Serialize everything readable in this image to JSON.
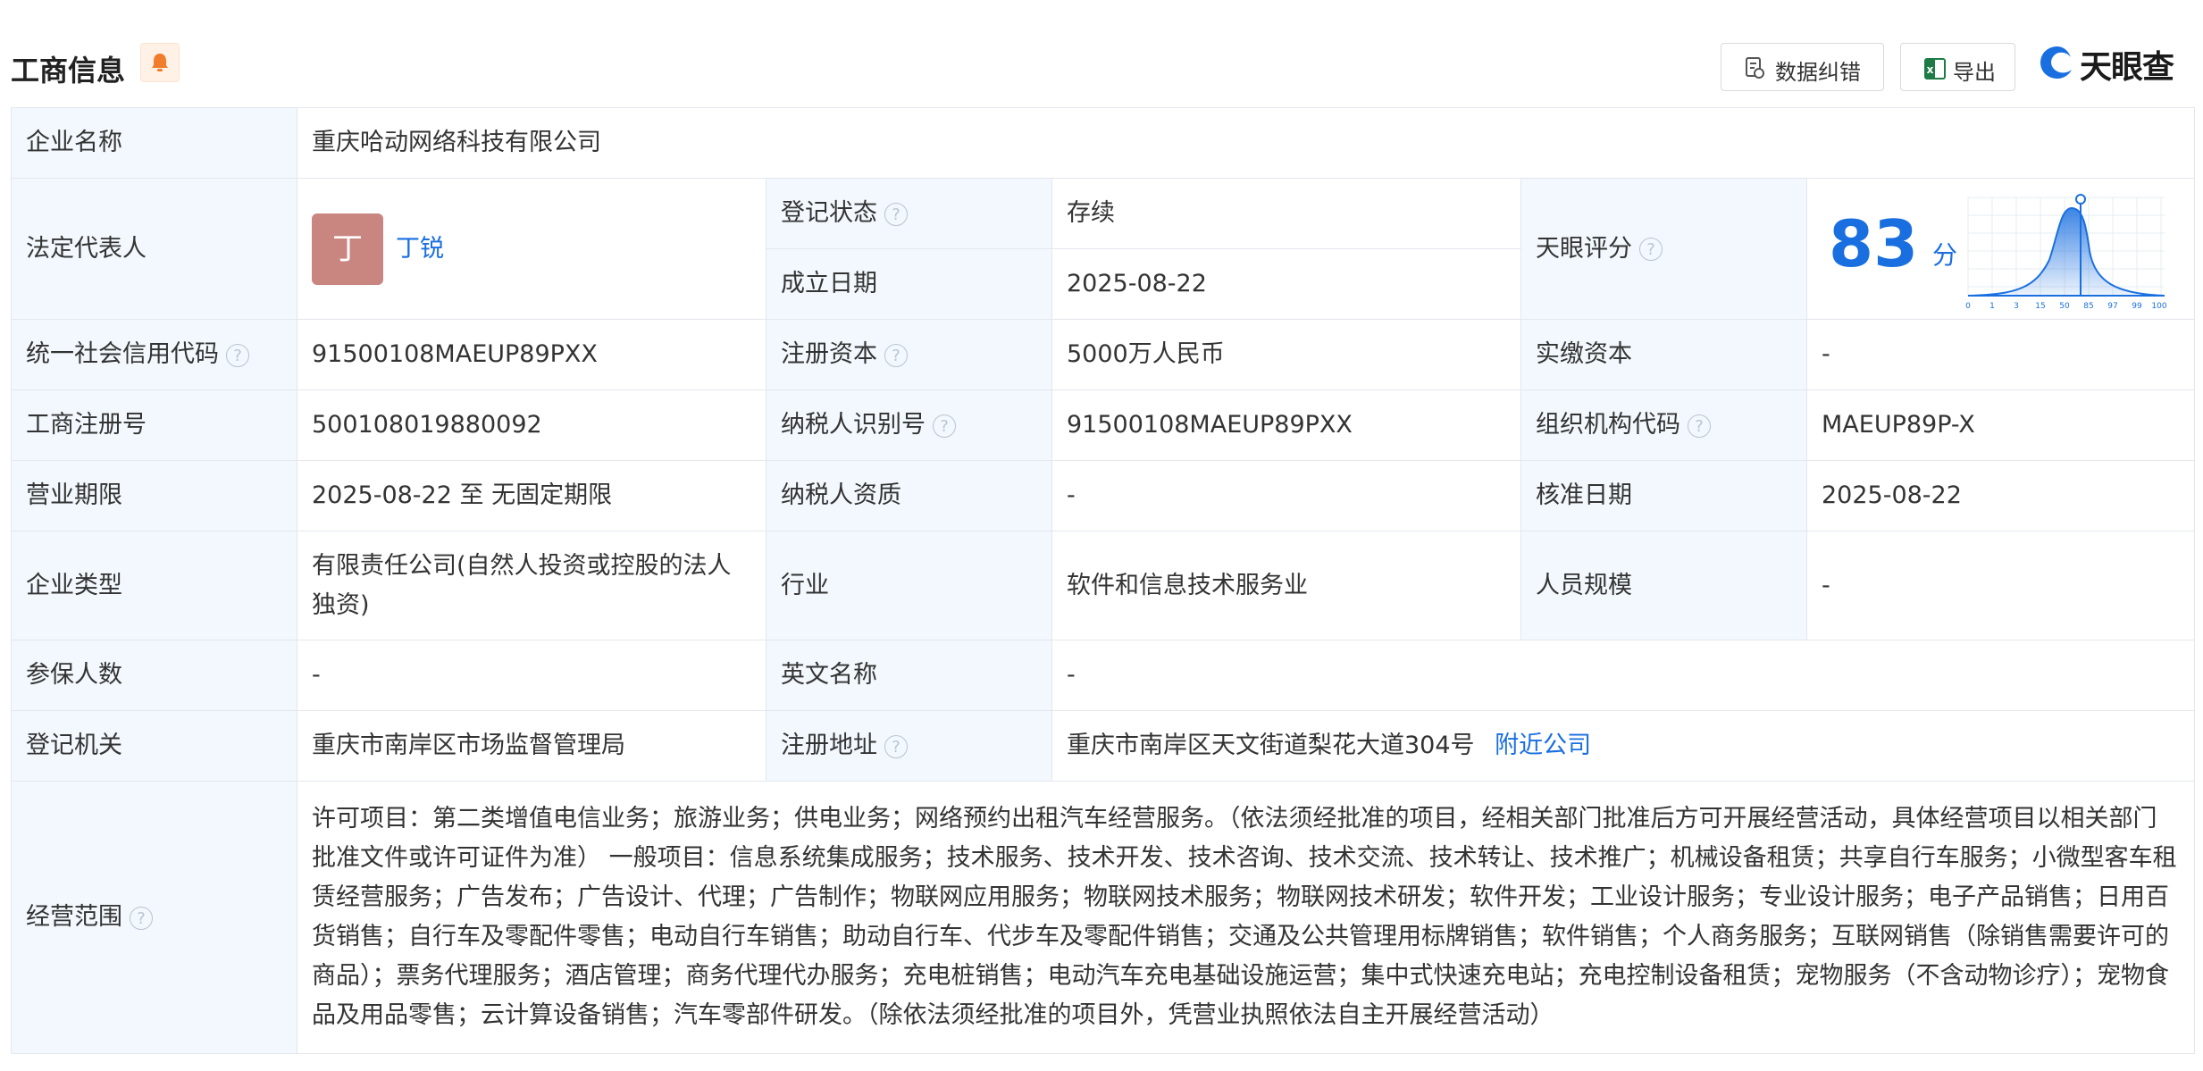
{
  "header": {
    "title": "工商信息",
    "bell_icon": "bell-icon",
    "correct_label": "数据纠错",
    "export_label": "导出",
    "brand": "天眼查",
    "brand_color": "#1a6fe0"
  },
  "rows": {
    "company_name": {
      "label": "企业名称",
      "value": "重庆哈动网络科技有限公司"
    },
    "legal_rep": {
      "label": "法定代表人",
      "avatar_char": "丁",
      "name": "丁锐"
    },
    "reg_status": {
      "label": "登记状态",
      "value": "存续"
    },
    "found_date": {
      "label": "成立日期",
      "value": "2025-08-22"
    },
    "tianyan_score": {
      "label": "天眼评分",
      "score": "83",
      "unit": "分",
      "ticks": [
        "0",
        "1",
        "3",
        "15",
        "50",
        "85",
        "97",
        "99",
        "100"
      ]
    },
    "credit_code": {
      "label": "统一社会信用代码",
      "value": "91500108MAEUP89PXX"
    },
    "reg_capital": {
      "label": "注册资本",
      "value": "5000万人民币"
    },
    "paid_capital": {
      "label": "实缴资本",
      "value": "-"
    },
    "reg_number": {
      "label": "工商注册号",
      "value": "500108019880092"
    },
    "taxpayer_id": {
      "label": "纳税人识别号",
      "value": "91500108MAEUP89PXX"
    },
    "org_code": {
      "label": "组织机构代码",
      "value": "MAEUP89P-X"
    },
    "term": {
      "label": "营业期限",
      "value": "2025-08-22 至 无固定期限"
    },
    "taxpayer_qual": {
      "label": "纳税人资质",
      "value": "-"
    },
    "approve_date": {
      "label": "核准日期",
      "value": "2025-08-22"
    },
    "company_type": {
      "label": "企业类型",
      "value": "有限责任公司(自然人投资或控股的法人独资)"
    },
    "industry": {
      "label": "行业",
      "value": "软件和信息技术服务业"
    },
    "staff_size": {
      "label": "人员规模",
      "value": "-"
    },
    "insured": {
      "label": "参保人数",
      "value": "-"
    },
    "english_name": {
      "label": "英文名称",
      "value": "-"
    },
    "authority": {
      "label": "登记机关",
      "value": "重庆市南岸区市场监督管理局"
    },
    "address": {
      "label": "注册地址",
      "value": "重庆市南岸区天文街道梨花大道304号",
      "nearby": "附近公司"
    },
    "scope": {
      "label": "经营范围",
      "value": "许可项目：第二类增值电信业务；旅游业务；供电业务；网络预约出租汽车经营服务。（依法须经批准的项目，经相关部门批准后方可开展经营活动，具体经营项目以相关部门批准文件或许可证件为准） 一般项目：信息系统集成服务；技术服务、技术开发、技术咨询、技术交流、技术转让、技术推广；机械设备租赁；共享自行车服务；小微型客车租赁经营服务；广告发布；广告设计、代理；广告制作；物联网应用服务；物联网技术服务；物联网技术研发；软件开发；工业设计服务；专业设计服务；电子产品销售；日用百货销售；自行车及零配件零售；电动自行车销售；助动自行车、代步车及零配件销售；交通及公共管理用标牌销售；软件销售；个人商务服务；互联网销售（除销售需要许可的商品）；票务代理服务；酒店管理；商务代理代办服务；充电桩销售；电动汽车充电基础设施运营；集中式快速充电站；充电控制设备租赁；宠物服务（不含动物诊疗）；宠物食品及用品零售；云计算设备销售；汽车零部件研发。（除依法须经批准的项目外，凭营业执照依法自主开展经营活动）"
    }
  }
}
